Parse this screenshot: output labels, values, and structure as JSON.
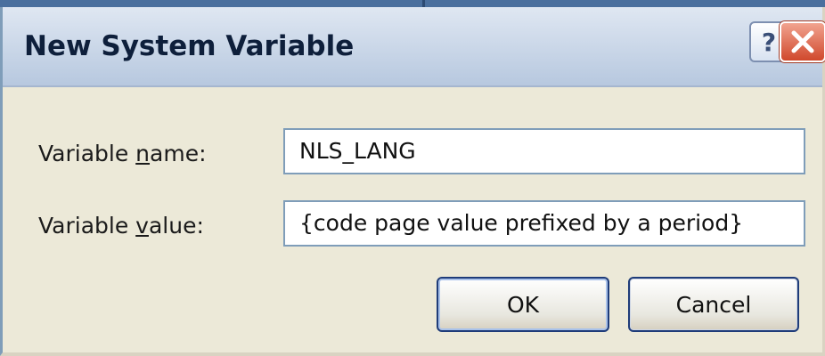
{
  "dialog": {
    "title": "New System Variable",
    "help_button": "?",
    "close_icon": "close-x-icon",
    "name_label": {
      "before": "Variable ",
      "accel": "n",
      "after": "ame:"
    },
    "name_value": "NLS_LANG",
    "value_label": {
      "before": "Variable ",
      "accel": "v",
      "after": "alue:"
    },
    "value_value": "{code page value prefixed by a period}",
    "ok_label": "OK",
    "cancel_label": "Cancel"
  },
  "colors": {
    "titlebar": "#c7d5e8",
    "dialog_bg": "#ece9d8",
    "close_button": "#d0482c",
    "button_border": "#1f3c79"
  }
}
